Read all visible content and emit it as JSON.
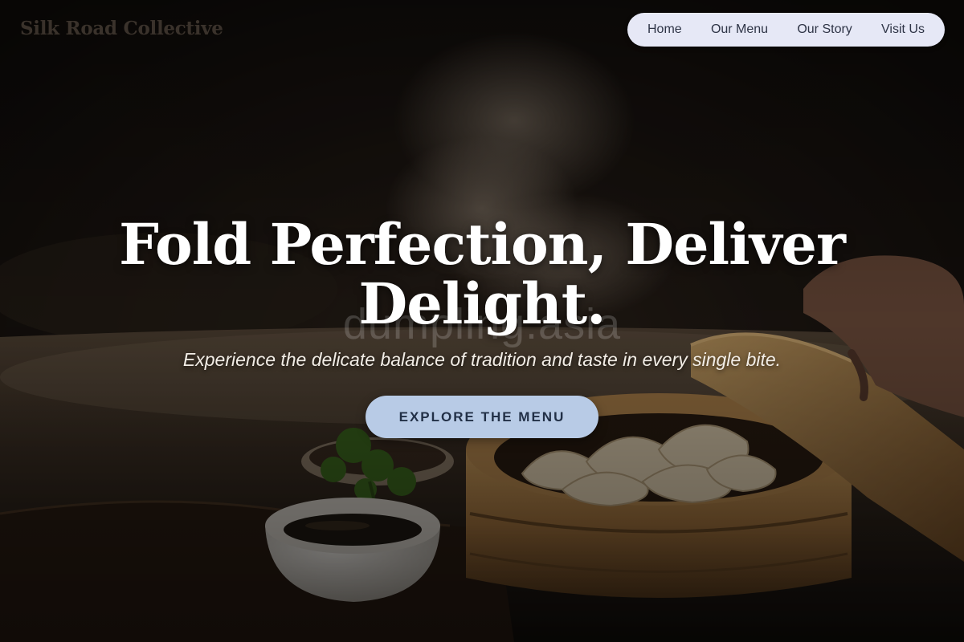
{
  "brand": {
    "name": "Silk Road Collective"
  },
  "nav": {
    "items": [
      {
        "label": "Home"
      },
      {
        "label": "Our Menu"
      },
      {
        "label": "Our Story"
      },
      {
        "label": "Visit Us"
      }
    ]
  },
  "hero": {
    "headline_line1": "Fold Perfection, Deliver",
    "headline_line2": "Delight.",
    "watermark": "dumpling.asia",
    "tagline": "Experience the delicate balance of tradition and taste in every single bite.",
    "cta_label": "EXPLORE THE MENU"
  },
  "colors": {
    "nav_background": "#e6e8f6",
    "cta_background": "#b8cbe6",
    "cta_text": "#223047",
    "headline": "#ffffff"
  }
}
